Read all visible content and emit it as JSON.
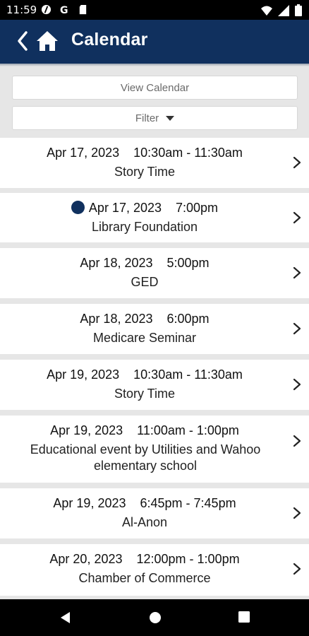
{
  "status_bar": {
    "time": "11:59",
    "left_icons": [
      "data-saver-icon",
      "google-icon",
      "sd-card-icon"
    ],
    "right_icons": [
      "wifi-icon",
      "signal-icon",
      "battery-icon"
    ]
  },
  "app_bar": {
    "title": "Calendar",
    "back_icon": "chevron-left-icon",
    "home_icon": "home-icon",
    "background": "#10305e"
  },
  "controls": {
    "view_calendar_label": "View Calendar",
    "filter_label": "Filter"
  },
  "events": [
    {
      "date": "Apr 17, 2023",
      "time": "10:30am - 11:30am",
      "title": "Story Time",
      "marked": false
    },
    {
      "date": "Apr 17, 2023",
      "time": "7:00pm",
      "title": "Library Foundation",
      "marked": true
    },
    {
      "date": "Apr 18, 2023",
      "time": "5:00pm",
      "title": "GED",
      "marked": false
    },
    {
      "date": "Apr 18, 2023",
      "time": "6:00pm",
      "title": "Medicare Seminar",
      "marked": false
    },
    {
      "date": "Apr 19, 2023",
      "time": "10:30am - 11:30am",
      "title": "Story Time",
      "marked": false
    },
    {
      "date": "Apr 19, 2023",
      "time": "11:00am - 1:00pm",
      "title": "Educational event by Utilities and Wahoo elementary school",
      "marked": false
    },
    {
      "date": "Apr 19, 2023",
      "time": "6:45pm - 7:45pm",
      "title": "Al-Anon",
      "marked": false
    },
    {
      "date": "Apr 20, 2023",
      "time": "12:00pm - 1:00pm",
      "title": "Chamber of Commerce",
      "marked": false
    }
  ],
  "nav_bar": {
    "buttons": [
      "back-triangle-icon",
      "home-circle-icon",
      "recents-square-icon"
    ]
  },
  "colors": {
    "accent": "#10305e",
    "list_background": "#e6e6e6"
  }
}
